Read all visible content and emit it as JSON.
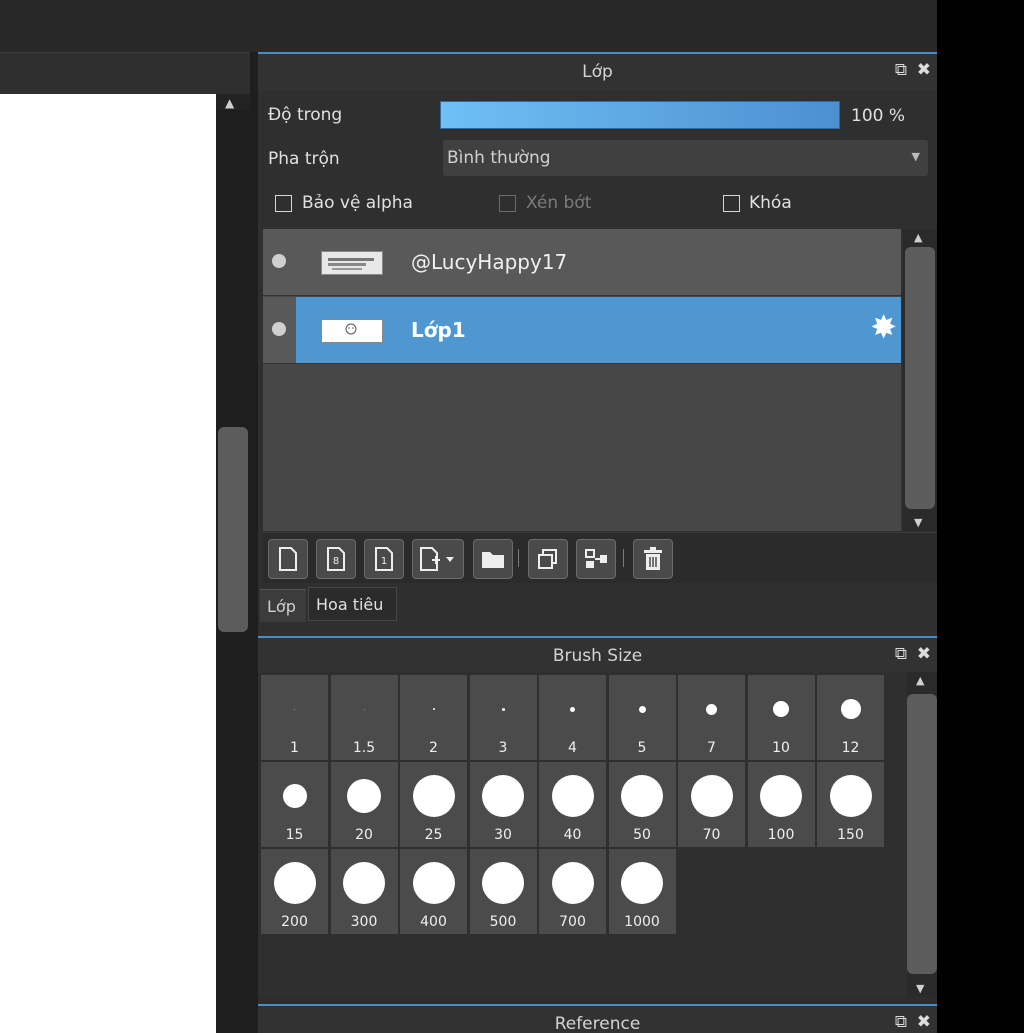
{
  "layer_panel": {
    "title": "Lớp",
    "opacity_label": "Độ trong",
    "opacity_value": "100 %",
    "opacity_fraction": 1.0,
    "blend_label": "Pha trộn",
    "blend_value": "Bình thường",
    "protect_alpha_label": "Bảo vệ alpha",
    "clipping_label": "Xén bớt",
    "lock_label": "Khóa",
    "layers": [
      {
        "name": "@LucyHappy17",
        "selected": false
      },
      {
        "name": "Lớp1",
        "selected": true
      }
    ]
  },
  "tabs": [
    "Lớp",
    "Hoa tiêu"
  ],
  "brush_panel": {
    "title": "Brush Size",
    "sizes": [
      "1",
      "1.5",
      "2",
      "3",
      "4",
      "5",
      "7",
      "10",
      "12",
      "15",
      "20",
      "25",
      "30",
      "40",
      "50",
      "70",
      "100",
      "150",
      "200",
      "300",
      "400",
      "500",
      "700",
      "1000"
    ]
  },
  "reference_panel": {
    "title": "Reference"
  },
  "colors": {
    "accent": "#4f97d0",
    "panel_bg": "#2f2f2f",
    "canvas": "#ffffff"
  }
}
